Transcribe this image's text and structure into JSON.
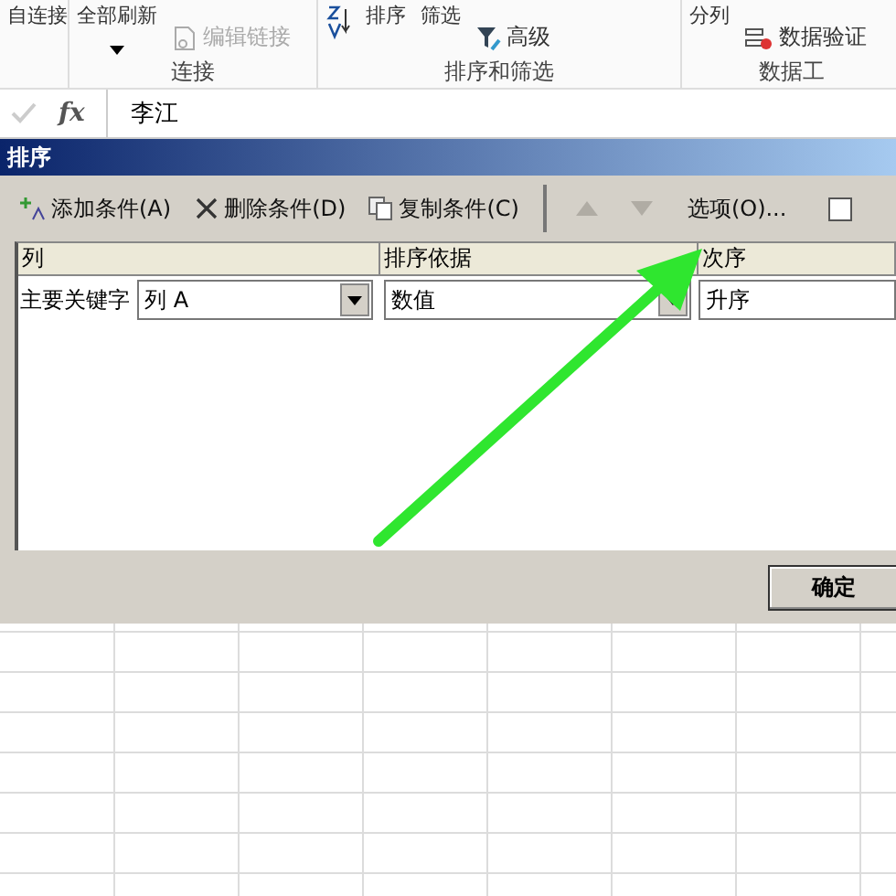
{
  "ribbon": {
    "groups": [
      {
        "commands": [
          {
            "label": "自连接",
            "kind": "large",
            "disabled": false
          }
        ]
      },
      {
        "label": "连接",
        "commands": [
          {
            "label": "全部刷新",
            "kind": "large",
            "disabled": false
          },
          {
            "label": "编辑链接",
            "kind": "small",
            "disabled": true
          }
        ]
      },
      {
        "label": "排序和筛选",
        "commands": [
          {
            "label": "排序",
            "kind": "large",
            "disabled": false
          },
          {
            "label": "筛选",
            "kind": "large",
            "disabled": false
          },
          {
            "label": "高级",
            "kind": "small",
            "disabled": false
          }
        ]
      },
      {
        "label": "数据工",
        "commands": [
          {
            "label": "分列",
            "kind": "large",
            "disabled": false
          },
          {
            "label": "数据验证",
            "kind": "small",
            "disabled": false
          }
        ]
      }
    ]
  },
  "formula_bar": {
    "fx": "fx",
    "value": "李江"
  },
  "dialog": {
    "title": "排序",
    "toolbar": [
      {
        "label": "添加条件(A)",
        "disabled": false
      },
      {
        "label": "删除条件(D)",
        "disabled": false
      },
      {
        "label": "复制条件(C)",
        "disabled": false
      }
    ],
    "move_up": {
      "disabled": true
    },
    "move_down": {
      "disabled": true
    },
    "options_button": "选项(O)...",
    "header_checkbox": {
      "checked": false
    },
    "columns": [
      "列",
      "排序依据",
      "次序"
    ],
    "rows": [
      {
        "label": "主要关键字",
        "column": "列 A",
        "sort_on": "数值",
        "order": "升序"
      }
    ],
    "buttons": [
      "确定"
    ]
  },
  "annotation": {
    "kind": "arrow"
  }
}
